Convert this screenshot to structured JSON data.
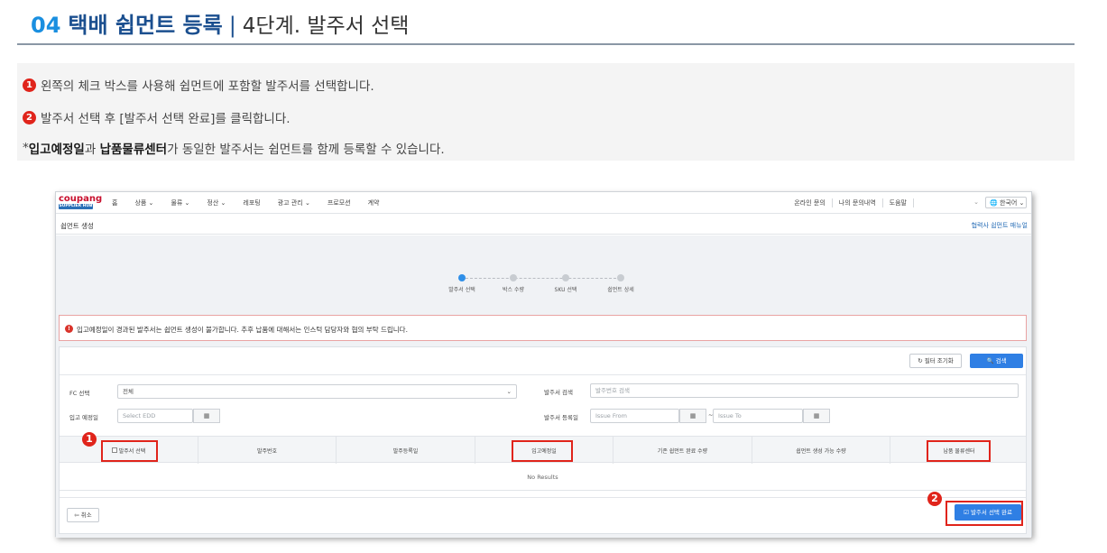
{
  "heading": {
    "number": "04",
    "main": "택배 쉽먼트 등록",
    "separator": "|",
    "sub": "4단계. 발주서 선택"
  },
  "instructions": {
    "line1_badge": "1",
    "line1": "왼쪽의 체크 박스를 사용해 쉽먼트에 포함할 발주서를 선택합니다.",
    "line2_badge": "2",
    "line2": "발주서 선택 후 [발주서 선택 완료]를 클릭합니다.",
    "line3_prefix": "*",
    "line3_em1": "입고예정일",
    "line3_mid": "과 ",
    "line3_em2": "납품물류센터",
    "line3_suffix": "가 동일한 발주서는 쉽먼트를 함께 등록할 수 있습니다."
  },
  "app": {
    "logo_text": "coupang",
    "logo_sub": "SUPPLIER HUB",
    "nav_items": [
      "홈",
      "상품 ⌄",
      "물류 ⌄",
      "정산 ⌄",
      "레포팅",
      "광고 관리 ⌄",
      "프로모션",
      "계약"
    ],
    "nav_right": [
      "온라인 문의",
      "나의 문의내역",
      "도움말"
    ],
    "blank_dropdown": "⌄",
    "language": "🌐 한국어 ⌄",
    "page_title": "쉽먼트 생성",
    "manual_link": "협력사 쉽먼트 매뉴얼",
    "steps": [
      {
        "label": "발주서 선택",
        "active": true
      },
      {
        "label": "박스 수량",
        "active": false
      },
      {
        "label": "SKU 선택",
        "active": false
      },
      {
        "label": "쉽먼트 상세",
        "active": false
      }
    ],
    "alert_icon": "!",
    "alert_text": "입고예정일이 경과된 발주서는 쉽먼트 생성이 불가합니다. 추후 납품에 대해서는 인스턱 담당자와 협의 부탁 드립니다.",
    "reset_button": "↻ 필터 조기화",
    "search_button": "🔍 검색",
    "filters": {
      "fc_label": "FC 선택",
      "fc_value": "전체",
      "po_search_label": "발주서 검색",
      "po_search_placeholder": "발주번호 검색",
      "edd_label": "입고 예정일",
      "edd_placeholder": "Select EDD",
      "po_date_label": "발주서 등록일",
      "issue_from": "Issue From",
      "issue_to": "Issue To",
      "tilde": "~",
      "calendar_icon": "▦"
    },
    "columns": [
      "발주서 선택",
      "발주번호",
      "발주등록일",
      "입고예정일",
      "기존 쉽먼트 완료 수량",
      "쉽먼트 생성 가능 수량",
      "납품 물류센터"
    ],
    "empty_text": "No Results",
    "cancel_button": "⇦ 취소",
    "done_button": "☑ 발주서 선택 완료"
  },
  "annotations": {
    "marker1": "1",
    "marker2": "2",
    "highlight_color": "#e0241b"
  }
}
